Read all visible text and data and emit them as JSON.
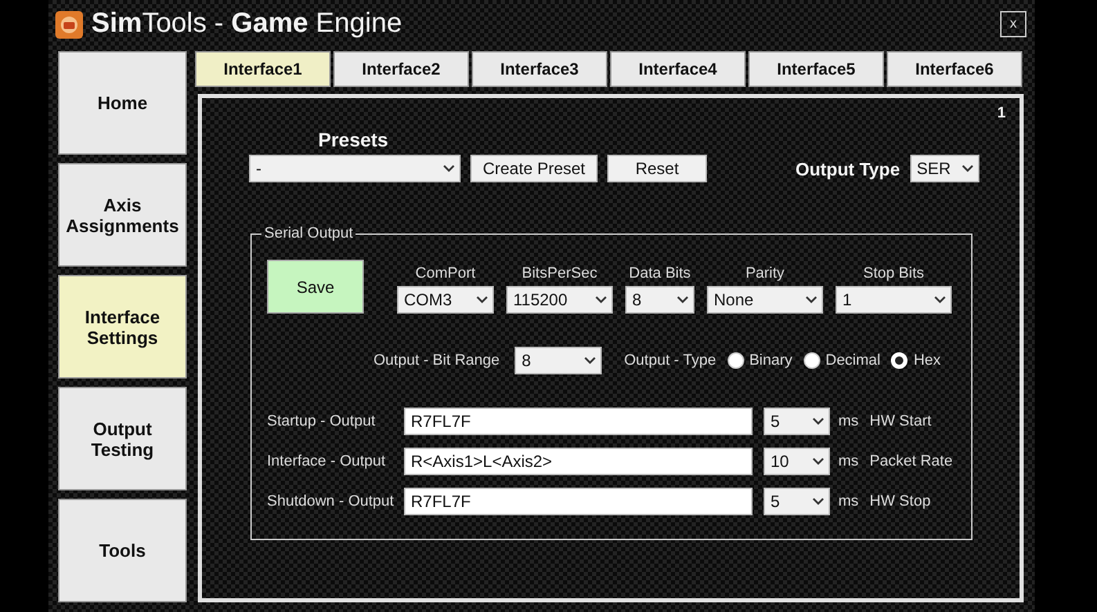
{
  "window": {
    "title": "**Sim**Tools - **Game** Engine",
    "close": "x"
  },
  "sidebar": {
    "items": [
      {
        "label": "Home",
        "selected": false
      },
      {
        "label": "Axis Assignments",
        "selected": false
      },
      {
        "label": "Interface Settings",
        "selected": true
      },
      {
        "label": "Output Testing",
        "selected": false
      },
      {
        "label": "Tools",
        "selected": false
      }
    ]
  },
  "tabs": [
    {
      "label": "Interface1",
      "selected": true
    },
    {
      "label": "Interface2",
      "selected": false
    },
    {
      "label": "Interface3",
      "selected": false
    },
    {
      "label": "Interface4",
      "selected": false
    },
    {
      "label": "Interface5",
      "selected": false
    },
    {
      "label": "Interface6",
      "selected": false
    }
  ],
  "panel": {
    "number": "1",
    "presets": {
      "label": "Presets",
      "value": "-",
      "buttons": [
        "Create Preset",
        "Reset"
      ]
    },
    "output_type": {
      "label": "Output Type",
      "value": "SER"
    },
    "serial_output": {
      "title": "Serial Output",
      "save": "Save",
      "settings": [
        {
          "label": "ComPort",
          "value": "COM3"
        },
        {
          "label": "BitsPerSec",
          "value": "115200"
        },
        {
          "label": "Data Bits",
          "value": "8"
        },
        {
          "label": "Parity",
          "value": "None"
        },
        {
          "label": "Stop Bits",
          "value": "1"
        }
      ],
      "bit_range": {
        "label": "Output - Bit Range",
        "value": "8"
      },
      "output_format": {
        "label": "Output - Type",
        "options": [
          {
            "label": "Binary",
            "selected": false
          },
          {
            "label": "Decimal",
            "selected": false
          },
          {
            "label": "Hex",
            "selected": true
          }
        ]
      },
      "outputs": [
        {
          "label": "Startup - Output",
          "value": "R7FL7F",
          "interval": "5",
          "unit": "ms",
          "note": "HW Start"
        },
        {
          "label": "Interface - Output",
          "value": "R<Axis1>L<Axis2>",
          "interval": "10",
          "unit": "ms",
          "note": "Packet Rate"
        },
        {
          "label": "Shutdown - Output",
          "value": "R7FL7F",
          "interval": "5",
          "unit": "ms",
          "note": "HW Stop"
        }
      ]
    }
  }
}
